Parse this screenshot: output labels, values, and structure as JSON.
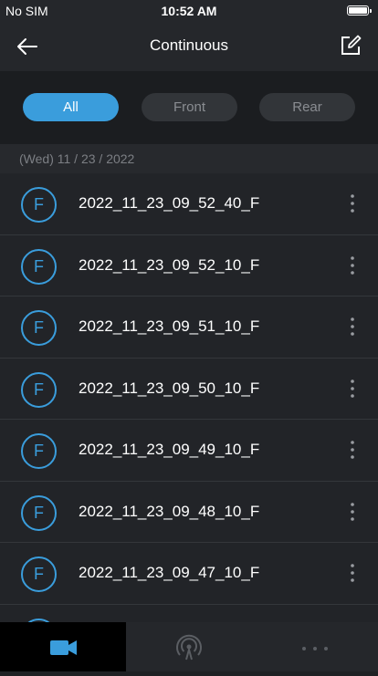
{
  "status_bar": {
    "carrier": "No SIM",
    "time": "10:52 AM",
    "battery_level": 1.0
  },
  "nav": {
    "title": "Continuous",
    "back_icon": "arrow-left-icon",
    "edit_icon": "edit-icon"
  },
  "filters": [
    {
      "label": "All",
      "active": true
    },
    {
      "label": "Front",
      "active": false
    },
    {
      "label": "Rear",
      "active": false
    }
  ],
  "date_header": "(Wed) 11 / 23 / 2022",
  "recordings": [
    {
      "badge": "F",
      "name": "2022_11_23_09_52_40_F"
    },
    {
      "badge": "F",
      "name": "2022_11_23_09_52_10_F"
    },
    {
      "badge": "F",
      "name": "2022_11_23_09_51_10_F"
    },
    {
      "badge": "F",
      "name": "2022_11_23_09_50_10_F"
    },
    {
      "badge": "F",
      "name": "2022_11_23_09_49_10_F"
    },
    {
      "badge": "F",
      "name": "2022_11_23_09_48_10_F"
    },
    {
      "badge": "F",
      "name": "2022_11_23_09_47_10_F"
    }
  ],
  "tabs": [
    {
      "icon": "video-camera-icon",
      "active": true
    },
    {
      "icon": "wireless-broadcast-icon",
      "active": false
    },
    {
      "icon": "more-horizontal-icon",
      "active": false
    }
  ],
  "colors": {
    "accent": "#3a9ddc",
    "background": "#1f2124",
    "bar": "#25272b"
  }
}
